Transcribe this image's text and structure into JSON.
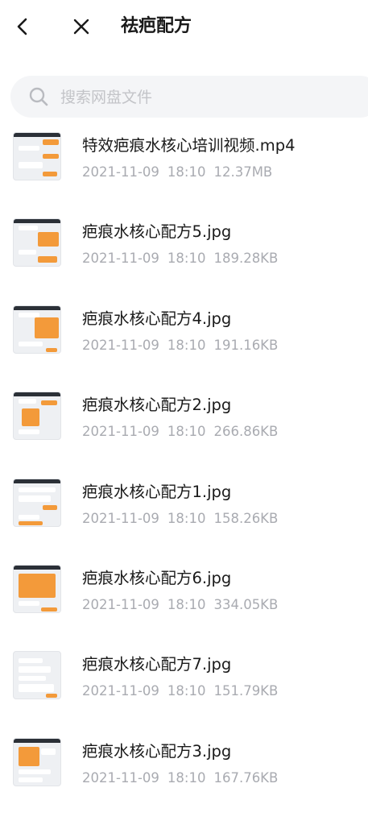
{
  "header": {
    "back_icon": "chevron-left-icon",
    "close_icon": "close-icon",
    "title": "祛疤配方"
  },
  "search": {
    "placeholder": "搜索网盘文件",
    "icon": "search-icon"
  },
  "files": [
    {
      "name": "特效疤痕水核心培训视频.mp4",
      "date": "2021-11-09",
      "time": "18:10",
      "size": "12.37MB"
    },
    {
      "name": "疤痕水核心配方5.jpg",
      "date": "2021-11-09",
      "time": "18:10",
      "size": "189.28KB"
    },
    {
      "name": "疤痕水核心配方4.jpg",
      "date": "2021-11-09",
      "time": "18:10",
      "size": "191.16KB"
    },
    {
      "name": "疤痕水核心配方2.jpg",
      "date": "2021-11-09",
      "time": "18:10",
      "size": "266.86KB"
    },
    {
      "name": "疤痕水核心配方1.jpg",
      "date": "2021-11-09",
      "time": "18:10",
      "size": "158.26KB"
    },
    {
      "name": "疤痕水核心配方6.jpg",
      "date": "2021-11-09",
      "time": "18:10",
      "size": "334.05KB"
    },
    {
      "name": "疤痕水核心配方7.jpg",
      "date": "2021-11-09",
      "time": "18:10",
      "size": "151.79KB"
    },
    {
      "name": "疤痕水核心配方3.jpg",
      "date": "2021-11-09",
      "time": "18:10",
      "size": "167.76KB"
    }
  ],
  "colors": {
    "thumb_accent": "#f39a3a",
    "thumb_dark": "#2b3037",
    "meta_text": "#a9abb1"
  }
}
